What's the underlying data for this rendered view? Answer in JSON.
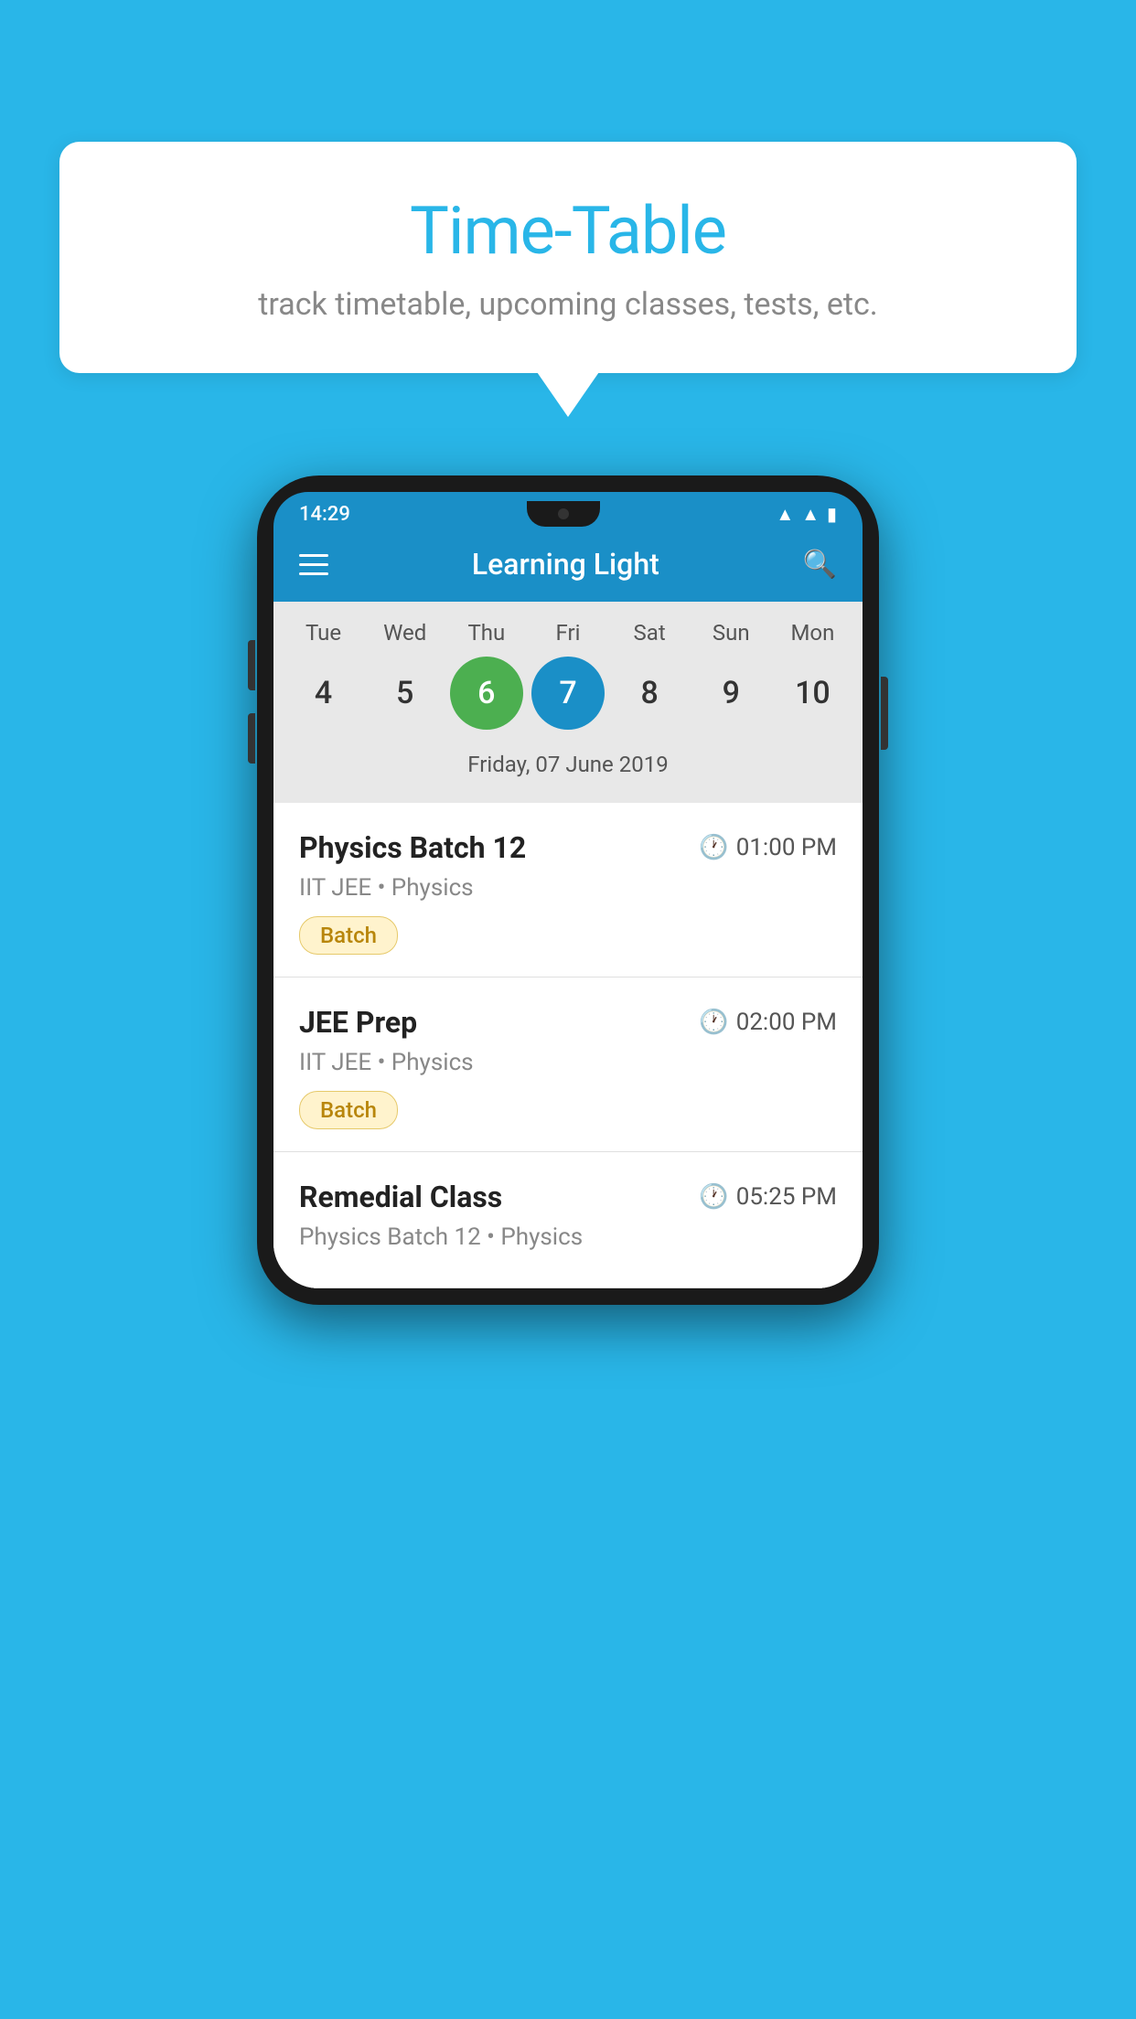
{
  "background_color": "#29b6e8",
  "speech_bubble": {
    "title": "Time-Table",
    "subtitle": "track timetable, upcoming classes, tests, etc."
  },
  "phone": {
    "status_bar": {
      "time": "14:29"
    },
    "app_bar": {
      "title": "Learning Light"
    },
    "calendar": {
      "days": [
        {
          "name": "Tue",
          "num": "4",
          "state": "normal"
        },
        {
          "name": "Wed",
          "num": "5",
          "state": "normal"
        },
        {
          "name": "Thu",
          "num": "6",
          "state": "today"
        },
        {
          "name": "Fri",
          "num": "7",
          "state": "selected"
        },
        {
          "name": "Sat",
          "num": "8",
          "state": "normal"
        },
        {
          "name": "Sun",
          "num": "9",
          "state": "normal"
        },
        {
          "name": "Mon",
          "num": "10",
          "state": "normal"
        }
      ],
      "selected_date_label": "Friday, 07 June 2019"
    },
    "schedule": [
      {
        "title": "Physics Batch 12",
        "time": "01:00 PM",
        "subtitle": "IIT JEE • Physics",
        "tag": "Batch"
      },
      {
        "title": "JEE Prep",
        "time": "02:00 PM",
        "subtitle": "IIT JEE • Physics",
        "tag": "Batch"
      },
      {
        "title": "Remedial Class",
        "time": "05:25 PM",
        "subtitle": "Physics Batch 12 • Physics",
        "tag": ""
      }
    ]
  }
}
